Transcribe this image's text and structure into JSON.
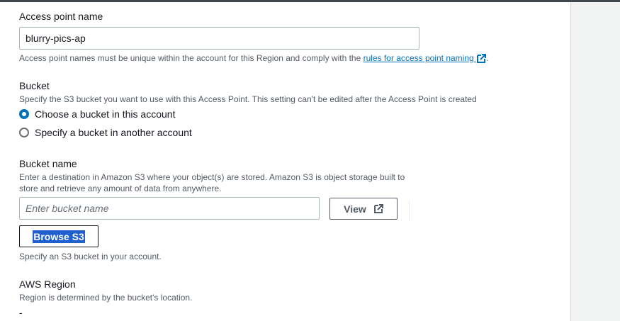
{
  "access_point": {
    "label": "Access point name",
    "value": "blurry-pics-ap",
    "help_prefix": "Access point names must be unique within the account for this Region and comply with the ",
    "help_link": "rules for access point naming",
    "help_suffix": "."
  },
  "bucket": {
    "label": "Bucket",
    "description": "Specify the S3 bucket you want to use with this Access Point. This setting can't be edited after the Access Point is created",
    "options": [
      {
        "label": "Choose a bucket in this account",
        "checked": true
      },
      {
        "label": "Specify a bucket in another account",
        "checked": false
      }
    ]
  },
  "bucket_name": {
    "label": "Bucket name",
    "description_line1": "Enter a destination in Amazon S3 where your object(s) are stored. Amazon S3 is object storage built to",
    "description_line2": "store and retrieve any amount of data from anywhere.",
    "placeholder": "Enter bucket name",
    "view_label": "View",
    "browse_label": "Browse S3",
    "help": "Specify an S3 bucket in your account."
  },
  "region": {
    "label": "AWS Region",
    "description": "Region is determined by the bucket's location.",
    "value": "-"
  },
  "colors": {
    "link": "#0073bb",
    "radio_selected": "#0073bb",
    "selection_highlight": "#2060cc"
  },
  "icons": [
    "external-link-icon"
  ]
}
